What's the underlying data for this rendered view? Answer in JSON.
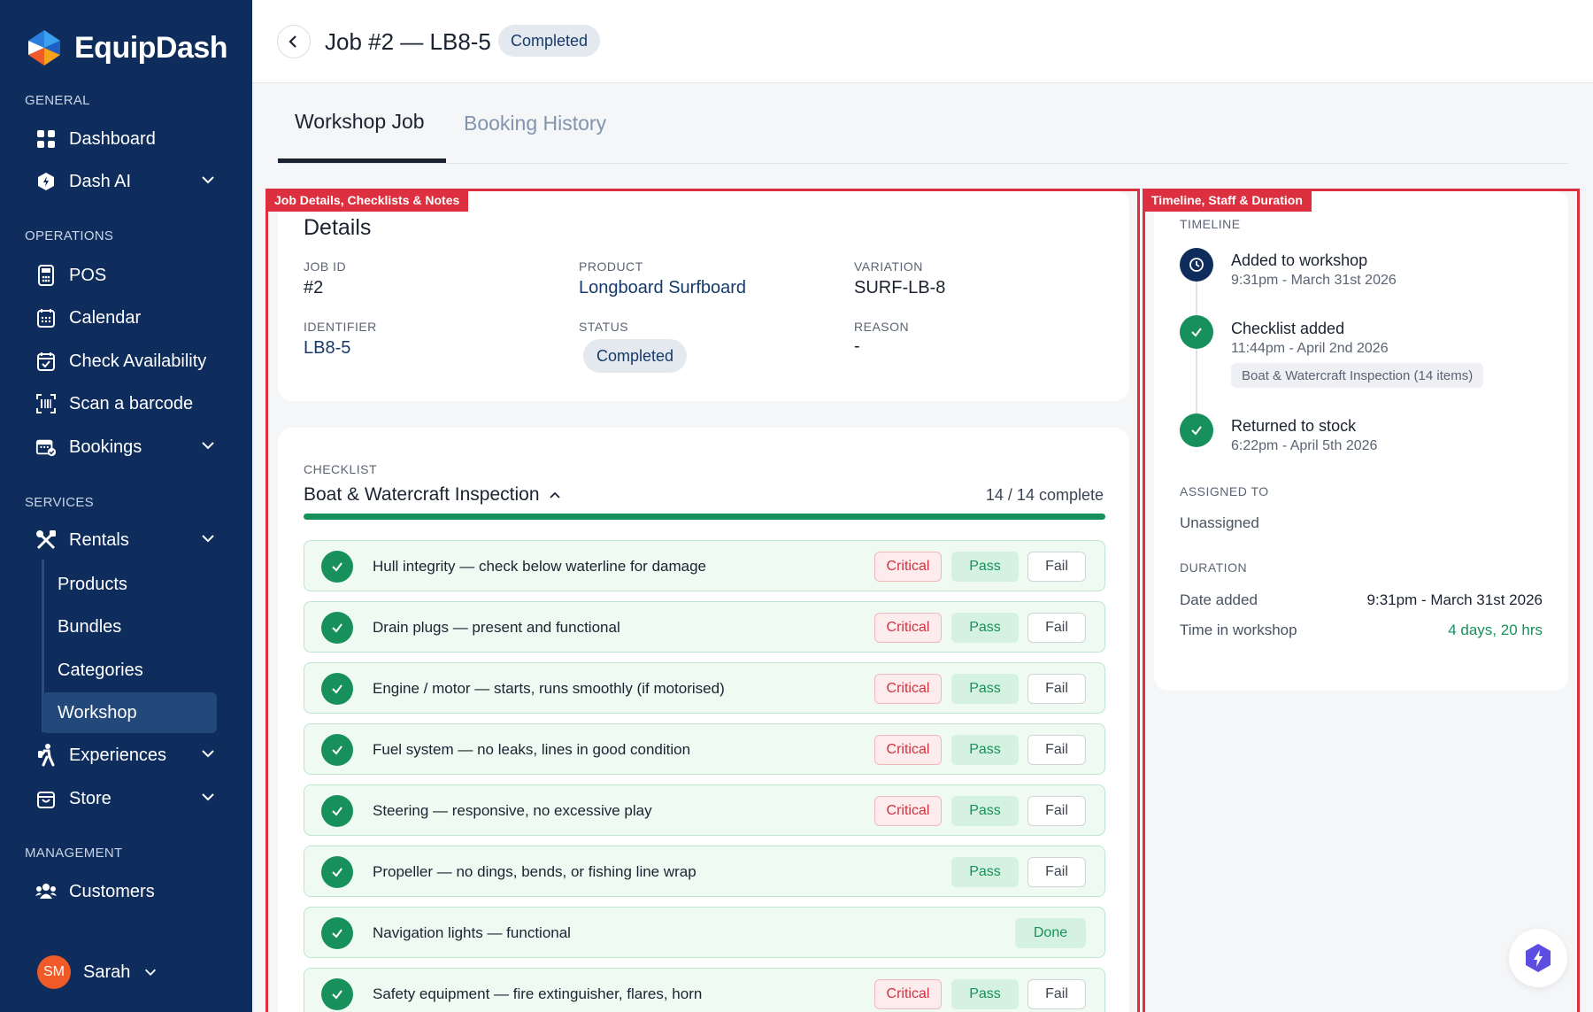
{
  "brand": {
    "name": "EquipDash"
  },
  "sidebar": {
    "sections": {
      "general": "GENERAL",
      "operations": "OPERATIONS",
      "services": "SERVICES",
      "management": "MANAGEMENT"
    },
    "items": {
      "dashboard": "Dashboard",
      "dash_ai": "Dash AI",
      "pos": "POS",
      "calendar": "Calendar",
      "check_availability": "Check Availability",
      "scan_barcode": "Scan a barcode",
      "bookings": "Bookings",
      "rentals": "Rentals",
      "products": "Products",
      "bundles": "Bundles",
      "categories": "Categories",
      "workshop": "Workshop",
      "experiences": "Experiences",
      "store": "Store",
      "customers": "Customers"
    },
    "user": {
      "initials": "SM",
      "name": "Sarah"
    }
  },
  "header": {
    "title": "Job #2 — LB8-5",
    "status_badge": "Completed"
  },
  "tabs": [
    {
      "label": "Workshop Job",
      "active": true
    },
    {
      "label": "Booking History",
      "active": false
    }
  ],
  "annotations": {
    "left": "Job Details, Checklists & Notes",
    "right": "Timeline, Staff & Duration"
  },
  "details": {
    "title": "Details",
    "job_id_label": "JOB ID",
    "job_id": "#2",
    "product_label": "PRODUCT",
    "product": "Longboard Surfboard",
    "variation_label": "VARIATION",
    "variation": "SURF-LB-8",
    "identifier_label": "IDENTIFIER",
    "identifier": "LB8-5",
    "status_label": "STATUS",
    "status": "Completed",
    "reason_label": "REASON",
    "reason": "-"
  },
  "checklist": {
    "label": "CHECKLIST",
    "title": "Boat & Watercraft Inspection",
    "count_text": "14 / 14 complete",
    "progress": 1.0,
    "critical_label": "Critical",
    "pass_label": "Pass",
    "fail_label": "Fail",
    "done_label": "Done",
    "items": [
      {
        "text": "Hull integrity — check below waterline for damage",
        "critical": true,
        "type": "passfail"
      },
      {
        "text": "Drain plugs — present and functional",
        "critical": true,
        "type": "passfail"
      },
      {
        "text": "Engine / motor — starts, runs smoothly (if motorised)",
        "critical": true,
        "type": "passfail"
      },
      {
        "text": "Fuel system — no leaks, lines in good condition",
        "critical": true,
        "type": "passfail"
      },
      {
        "text": "Steering — responsive, no excessive play",
        "critical": true,
        "type": "passfail"
      },
      {
        "text": "Propeller — no dings, bends, or fishing line wrap",
        "critical": false,
        "type": "passfail"
      },
      {
        "text": "Navigation lights — functional",
        "critical": false,
        "type": "done"
      },
      {
        "text": "Safety equipment — fire extinguisher, flares, horn",
        "critical": true,
        "type": "passfail"
      }
    ]
  },
  "timeline": {
    "label": "TIMELINE",
    "events": [
      {
        "title": "Added to workshop",
        "time": "9:31pm - March 31st 2026"
      },
      {
        "title": "Checklist added",
        "time": "11:44pm - April 2nd 2026",
        "chip": "Boat & Watercraft Inspection (14 items)"
      },
      {
        "title": "Returned to stock",
        "time": "6:22pm - April 5th 2026"
      }
    ]
  },
  "assigned": {
    "label": "ASSIGNED TO",
    "value": "Unassigned"
  },
  "duration": {
    "label": "DURATION",
    "date_added_label": "Date added",
    "date_added": "9:31pm - March 31st 2026",
    "time_in_workshop_label": "Time in workshop",
    "time_in_workshop": "4 days, 20 hrs"
  },
  "colors": {
    "sidebar_bg": "#0e2d5c",
    "success": "#17905c",
    "critical": "#d2313f",
    "annotation": "#dc2f3f"
  }
}
